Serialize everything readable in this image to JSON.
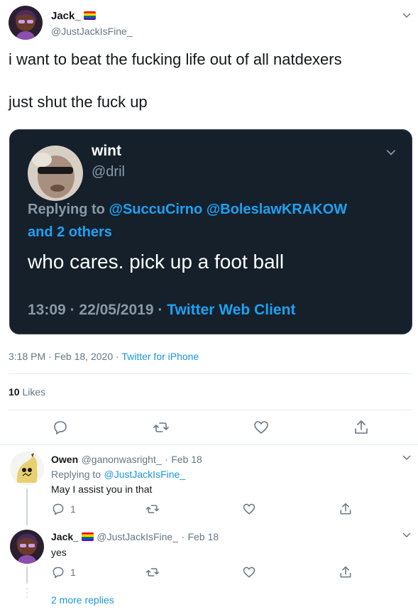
{
  "main_tweet": {
    "name": "Jack_",
    "handle": "@JustJackIsFine_",
    "text_line1": "i want to beat the fucking life out of all natdexers",
    "text_line2": "just shut the fuck up",
    "time": "3:18 PM",
    "date": "Feb 18, 2020",
    "source": "Twitter for iPhone",
    "likes_count": "10",
    "likes_label": "Likes"
  },
  "quoted_tweet": {
    "name": "wint",
    "handle": "@dril",
    "replying_prefix": "Replying to",
    "replying_user1": "@SuccuCirno",
    "replying_user2": "@BoleslawKRAKOW",
    "replying_others": "and 2 others",
    "text": "who cares. pick up a foot ball",
    "time": "13:09",
    "date": "22/05/2019",
    "source": "Twitter Web Client"
  },
  "replies": [
    {
      "name": "Owen",
      "handle": "@ganonwasright_",
      "date": "Feb 18",
      "replying_prefix": "Replying to",
      "replying_user": "@JustJackIsFine_",
      "text": "May I assist you in that",
      "reply_count": "1"
    },
    {
      "name": "Jack_",
      "handle": "@JustJackIsFine_",
      "date": "Feb 18",
      "text": "yes",
      "reply_count": "1"
    }
  ],
  "more_replies": "2 more replies",
  "separator": "·",
  "colors": {
    "link": "#1b95e0",
    "quote_bg": "#15202b",
    "muted": "#657786"
  },
  "icons": [
    "chevron-down-icon",
    "reply-icon",
    "retweet-icon",
    "like-icon",
    "share-icon",
    "rainbow-flag-icon"
  ]
}
